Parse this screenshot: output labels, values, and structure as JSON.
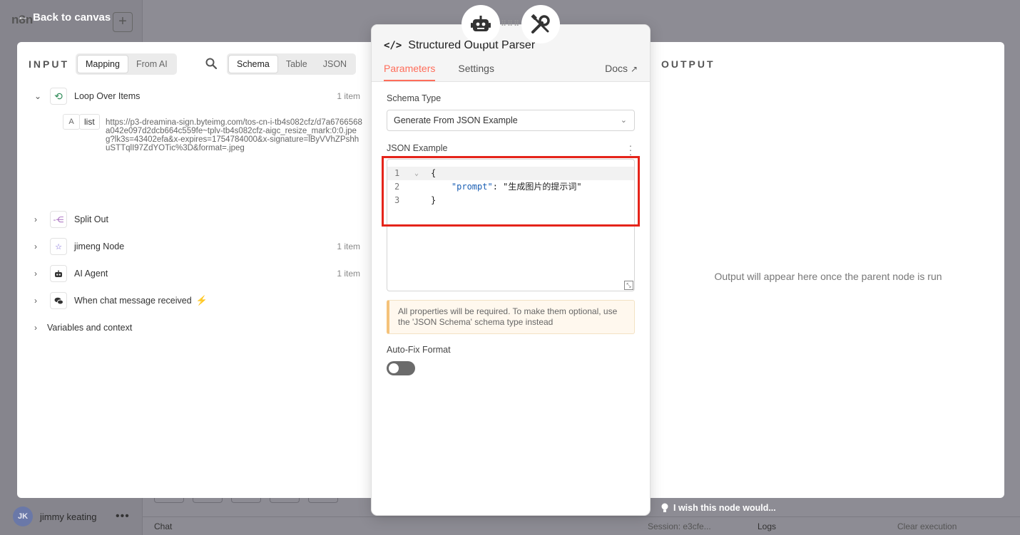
{
  "background": {
    "logo_text": "n8n",
    "user_name": "jimmy keating",
    "user_initials": "JK",
    "bottom_bar": {
      "chat_label": "Chat",
      "session_label": "Session: e3cfe...",
      "logs_label": "Logs",
      "clear_label": "Clear execution"
    }
  },
  "back_link": {
    "label": "Back to canvas"
  },
  "input_pane": {
    "title": "INPUT",
    "mapping_tabs": [
      {
        "label": "Mapping"
      },
      {
        "label": "From AI"
      }
    ],
    "view_tabs": [
      {
        "label": "Schema"
      },
      {
        "label": "Table"
      },
      {
        "label": "JSON"
      }
    ],
    "tree": [
      {
        "label": "Loop Over Items",
        "count": "1 item",
        "expanded": true
      },
      {
        "label": "Split Out",
        "count": ""
      },
      {
        "label": "jimeng Node",
        "count": "1 item"
      },
      {
        "label": "AI Agent",
        "count": "1 item"
      },
      {
        "label": "When chat message received",
        "count": ""
      },
      {
        "label": "Variables and context",
        "count": ""
      }
    ],
    "field": {
      "type_icon": "A",
      "key": "list",
      "value": "https://p3-dreamina-sign.byteimg.com/tos-cn-i-tb4s082cfz/d7a6766568a042e097d2dcb664c559fe~tplv-tb4s082cfz-aigc_resize_mark:0:0.jpeg?lk3s=43402efa&x-expires=1754784000&x-signature=lByVVhZPshhuSTTqlI97ZdYOTic%3D&format=.jpeg"
    }
  },
  "node_panel": {
    "title": "Structured Output Parser",
    "tabs": [
      {
        "label": "Parameters",
        "active": true
      },
      {
        "label": "Settings",
        "active": false
      }
    ],
    "docs_label": "Docs",
    "schema_type_label": "Schema Type",
    "schema_type_value": "Generate From JSON Example",
    "json_example_label": "JSON Example",
    "code_lines": [
      {
        "num": "1",
        "text": "{"
      },
      {
        "num": "2",
        "key": "\"prompt\"",
        "value": "\"生成图片的提示词\""
      },
      {
        "num": "3",
        "text": "}"
      }
    ],
    "notice": "All properties will be required. To make them optional, use the 'JSON Schema' schema type instead",
    "autofix_label": "Auto-Fix Format",
    "autofix_on": false
  },
  "output_pane": {
    "title": "OUTPUT",
    "message": "Output will appear here once the parent node is run"
  },
  "feedback": {
    "label": "I wish this node would..."
  },
  "colors": {
    "accent": "#ff6d5a",
    "highlight": "#e5241a"
  }
}
